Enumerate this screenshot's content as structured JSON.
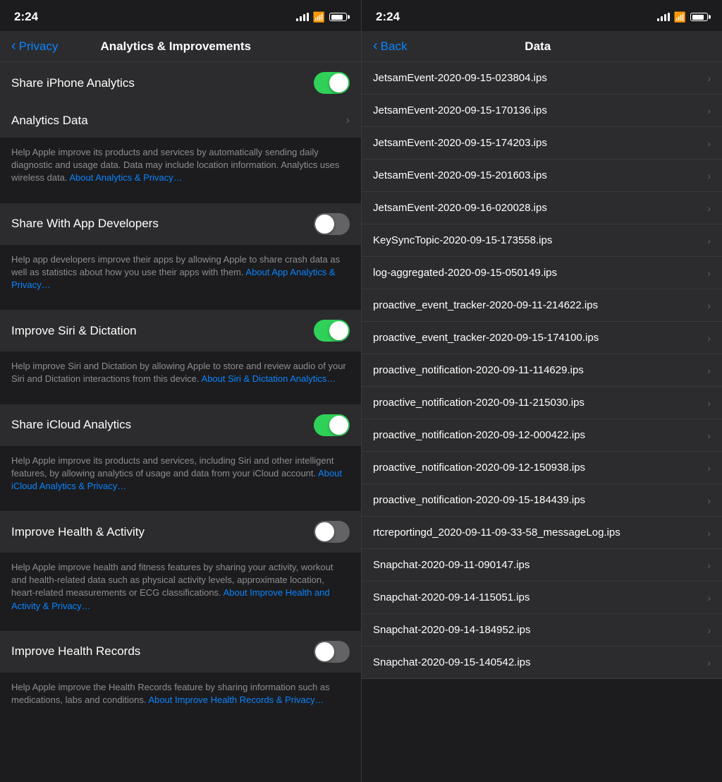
{
  "left": {
    "statusBar": {
      "time": "2:24"
    },
    "navBar": {
      "backLabel": "Privacy",
      "title": "Analytics & Improvements"
    },
    "settings": [
      {
        "id": "share-iphone-analytics",
        "label": "Share iPhone Analytics",
        "type": "toggle",
        "value": true
      },
      {
        "id": "analytics-data",
        "label": "Analytics Data",
        "type": "chevron",
        "value": null
      }
    ],
    "analyticsDescription": "Help Apple improve its products and services by automatically sending daily diagnostic and usage data. Data may include location information. Analytics uses wireless data.",
    "analyticsLink": "About Analytics & Privacy…",
    "shareWithDevelopers": {
      "label": "Share With App Developers",
      "type": "toggle",
      "value": false
    },
    "shareWithDevelopersDescription": "Help app developers improve their apps by allowing Apple to share crash data as well as statistics about how you use their apps with them.",
    "shareWithDevelopersLink": "About App Analytics & Privacy…",
    "improveSiri": {
      "label": "Improve Siri & Dictation",
      "type": "toggle",
      "value": true
    },
    "improveSiriDescription": "Help improve Siri and Dictation by allowing Apple to store and review audio of your Siri and Dictation interactions from this device.",
    "improveSiriLink": "About Siri & Dictation Analytics…",
    "shareICloud": {
      "label": "Share iCloud Analytics",
      "type": "toggle",
      "value": true
    },
    "shareICloudDescription": "Help Apple improve its products and services, including Siri and other intelligent features, by allowing analytics of usage and data from your iCloud account.",
    "shareICloudLink": "About iCloud Analytics & Privacy…",
    "improveHealth": {
      "label": "Improve Health & Activity",
      "type": "toggle",
      "value": false
    },
    "improveHealthDescription": "Help Apple improve health and fitness features by sharing your activity, workout and health-related data such as physical activity levels, approximate location, heart-related measurements or ECG classifications.",
    "improveHealthLink": "About Improve Health and Activity & Privacy…",
    "improveHealthRecords": {
      "label": "Improve Health Records",
      "type": "toggle",
      "value": false
    },
    "improveHealthRecordsDescription": "Help Apple improve the Health Records feature by sharing information such as medications, labs and conditions.",
    "improveHealthRecordsLink": "About Improve Health Records & Privacy…"
  },
  "right": {
    "statusBar": {
      "time": "2:24"
    },
    "navBar": {
      "backLabel": "Back",
      "title": "Data"
    },
    "items": [
      {
        "label": "JetsamEvent-2020-09-15-023804.ips"
      },
      {
        "label": "JetsamEvent-2020-09-15-170136.ips"
      },
      {
        "label": "JetsamEvent-2020-09-15-174203.ips"
      },
      {
        "label": "JetsamEvent-2020-09-15-201603.ips"
      },
      {
        "label": "JetsamEvent-2020-09-16-020028.ips"
      },
      {
        "label": "KeySyncTopic-2020-09-15-173558.ips"
      },
      {
        "label": "log-aggregated-2020-09-15-050149.ips"
      },
      {
        "label": "proactive_event_tracker-2020-09-11-214622.ips"
      },
      {
        "label": "proactive_event_tracker-2020-09-15-174100.ips"
      },
      {
        "label": "proactive_notification-2020-09-11-114629.ips"
      },
      {
        "label": "proactive_notification-2020-09-11-215030.ips"
      },
      {
        "label": "proactive_notification-2020-09-12-000422.ips"
      },
      {
        "label": "proactive_notification-2020-09-12-150938.ips"
      },
      {
        "label": "proactive_notification-2020-09-15-184439.ips"
      },
      {
        "label": "rtcreportingd_2020-09-11-09-33-58_messageLog.ips"
      },
      {
        "label": "Snapchat-2020-09-11-090147.ips"
      },
      {
        "label": "Snapchat-2020-09-14-115051.ips"
      },
      {
        "label": "Snapchat-2020-09-14-184952.ips"
      },
      {
        "label": "Snapchat-2020-09-15-140542.ips"
      }
    ]
  }
}
